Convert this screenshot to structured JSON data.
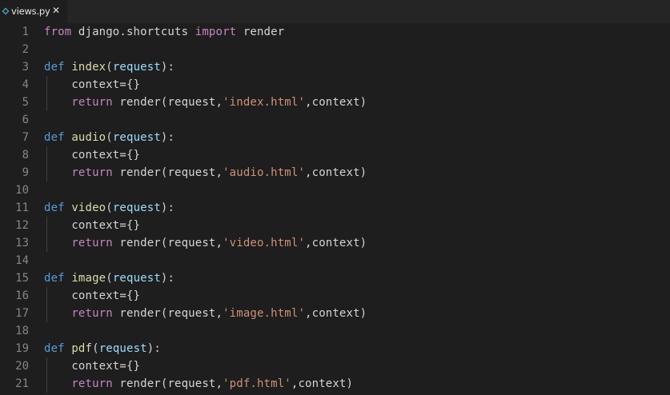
{
  "tab": {
    "filename": "views.py",
    "close_glyph": "✕",
    "icon": "python-file-icon"
  },
  "colors": {
    "background": "#1e1e1e",
    "keyword_control": "#c586c0",
    "keyword_def": "#569cd6",
    "function_name": "#dcdcaa",
    "parameter": "#9cdcfe",
    "string": "#ce9178",
    "text": "#d4d4d4",
    "line_number": "#858585"
  },
  "lines": [
    {
      "n": "1",
      "tokens": [
        [
          "kw",
          "from"
        ],
        [
          "txt",
          " django.shortcuts "
        ],
        [
          "kw",
          "import"
        ],
        [
          "txt",
          " render"
        ]
      ]
    },
    {
      "n": "2",
      "tokens": []
    },
    {
      "n": "3",
      "tokens": [
        [
          "def",
          "def"
        ],
        [
          "txt",
          " "
        ],
        [
          "fn",
          "index"
        ],
        [
          "txt",
          "("
        ],
        [
          "par",
          "request"
        ],
        [
          "txt",
          "):"
        ]
      ]
    },
    {
      "n": "4",
      "tokens": [
        [
          "txt",
          "    context={}"
        ]
      ]
    },
    {
      "n": "5",
      "tokens": [
        [
          "txt",
          "    "
        ],
        [
          "kw",
          "return"
        ],
        [
          "txt",
          " render(request,"
        ],
        [
          "str",
          "'index.html'"
        ],
        [
          "txt",
          ",context)"
        ]
      ]
    },
    {
      "n": "6",
      "tokens": []
    },
    {
      "n": "7",
      "tokens": [
        [
          "def",
          "def"
        ],
        [
          "txt",
          " "
        ],
        [
          "fn",
          "audio"
        ],
        [
          "txt",
          "("
        ],
        [
          "par",
          "request"
        ],
        [
          "txt",
          "):"
        ]
      ]
    },
    {
      "n": "8",
      "tokens": [
        [
          "txt",
          "    context={}"
        ]
      ]
    },
    {
      "n": "9",
      "tokens": [
        [
          "txt",
          "    "
        ],
        [
          "kw",
          "return"
        ],
        [
          "txt",
          " render(request,"
        ],
        [
          "str",
          "'audio.html'"
        ],
        [
          "txt",
          ",context)"
        ]
      ]
    },
    {
      "n": "10",
      "tokens": []
    },
    {
      "n": "11",
      "tokens": [
        [
          "def",
          "def"
        ],
        [
          "txt",
          " "
        ],
        [
          "fn",
          "video"
        ],
        [
          "txt",
          "("
        ],
        [
          "par",
          "request"
        ],
        [
          "txt",
          "):"
        ]
      ]
    },
    {
      "n": "12",
      "tokens": [
        [
          "txt",
          "    context={}"
        ]
      ]
    },
    {
      "n": "13",
      "tokens": [
        [
          "txt",
          "    "
        ],
        [
          "kw",
          "return"
        ],
        [
          "txt",
          " render(request,"
        ],
        [
          "str",
          "'video.html'"
        ],
        [
          "txt",
          ",context)"
        ]
      ]
    },
    {
      "n": "14",
      "tokens": []
    },
    {
      "n": "15",
      "tokens": [
        [
          "def",
          "def"
        ],
        [
          "txt",
          " "
        ],
        [
          "fn",
          "image"
        ],
        [
          "txt",
          "("
        ],
        [
          "par",
          "request"
        ],
        [
          "txt",
          "):"
        ]
      ]
    },
    {
      "n": "16",
      "tokens": [
        [
          "txt",
          "    context={}"
        ]
      ]
    },
    {
      "n": "17",
      "tokens": [
        [
          "txt",
          "    "
        ],
        [
          "kw",
          "return"
        ],
        [
          "txt",
          " render(request,"
        ],
        [
          "str",
          "'image.html'"
        ],
        [
          "txt",
          ",context)"
        ]
      ]
    },
    {
      "n": "18",
      "tokens": []
    },
    {
      "n": "19",
      "tokens": [
        [
          "def",
          "def"
        ],
        [
          "txt",
          " "
        ],
        [
          "fn",
          "pdf"
        ],
        [
          "txt",
          "("
        ],
        [
          "par",
          "request"
        ],
        [
          "txt",
          "):"
        ]
      ]
    },
    {
      "n": "20",
      "tokens": [
        [
          "txt",
          "    context={}"
        ]
      ]
    },
    {
      "n": "21",
      "tokens": [
        [
          "txt",
          "    "
        ],
        [
          "kw",
          "return"
        ],
        [
          "txt",
          " render(request,"
        ],
        [
          "str",
          "'pdf.html'"
        ],
        [
          "txt",
          ",context)"
        ]
      ]
    }
  ]
}
